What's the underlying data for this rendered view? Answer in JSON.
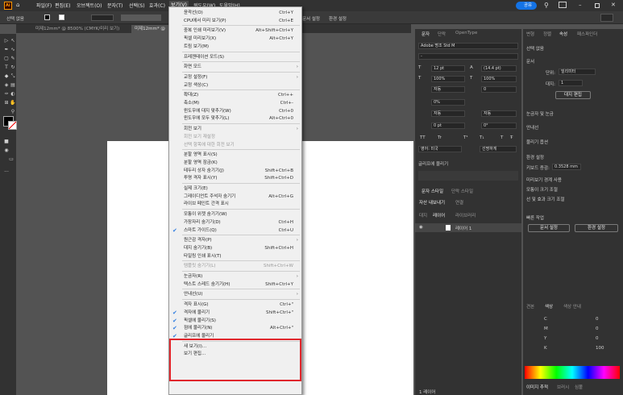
{
  "menubar": {
    "items": [
      "파일(F)",
      "편집(E)",
      "오브젝트(O)",
      "문자(T)",
      "선택(S)",
      "효과(C)",
      "보기(V)",
      "윈도우(W)",
      "도움말(H)"
    ],
    "share": "공유"
  },
  "control": {
    "selection": "선택 없음",
    "workspace_fields": [
      "스타일:",
      "문서 설정",
      "환경 설정"
    ]
  },
  "doc_tabs": [
    "미제12mm* @ 8500% (CMYK/미리 보기)",
    "미제12mm* @"
  ],
  "view_menu": {
    "items": [
      {
        "label": "윤곽선(O)",
        "shortcut": "Ctrl+Y"
      },
      {
        "label": "CPU에서 미리 보기(P)",
        "shortcut": "Ctrl+E"
      },
      {
        "sep": true
      },
      {
        "label": "중복 인쇄 미리보기(V)",
        "shortcut": "Alt+Shift+Ctrl+Y"
      },
      {
        "label": "픽셀 미리보기(X)",
        "shortcut": "Alt+Ctrl+Y"
      },
      {
        "label": "트림 보기(M)"
      },
      {
        "sep": true
      },
      {
        "label": "프레젠테이션 모드(S)"
      },
      {
        "sep": true
      },
      {
        "label": "화면 모드",
        "submenu": true
      },
      {
        "sep": true
      },
      {
        "label": "교정 설정(F)",
        "submenu": true
      },
      {
        "label": "교정 색상(C)"
      },
      {
        "sep": true
      },
      {
        "label": "확대(Z)",
        "shortcut": "Ctrl++"
      },
      {
        "label": "축소(M)",
        "shortcut": "Ctrl+-"
      },
      {
        "label": "윈도우에 대지 맞추기(W)",
        "shortcut": "Ctrl+0"
      },
      {
        "label": "윈도우에 모두 맞추기(L)",
        "shortcut": "Alt+Ctrl+0"
      },
      {
        "sep": true
      },
      {
        "label": "회전 보기",
        "submenu": true
      },
      {
        "label": "회전 보기 재설정",
        "disabled": true
      },
      {
        "label": "선택 항목에 대한 회전 보기",
        "disabled": true
      },
      {
        "sep": true
      },
      {
        "label": "분할 영역 표시(S)"
      },
      {
        "label": "분할 영역 잠금(K)"
      },
      {
        "label": "테두리 상자 숨기기(J)",
        "shortcut": "Shift+Ctrl+B"
      },
      {
        "label": "투명 격자 표시(Y)",
        "shortcut": "Shift+Ctrl+D"
      },
      {
        "sep": true
      },
      {
        "label": "실제 크기(E)"
      },
      {
        "label": "그레이디언트 주석자 숨기기",
        "shortcut": "Alt+Ctrl+G"
      },
      {
        "label": "라이브 페인트 간격 표시"
      },
      {
        "sep": true
      },
      {
        "label": "모퉁이 위젯 숨기기(W)"
      },
      {
        "label": "가장자리 숨기기(D)",
        "shortcut": "Ctrl+H"
      },
      {
        "label": "스마트 가이드(Q)",
        "shortcut": "Ctrl+U",
        "checked": true
      },
      {
        "sep": true
      },
      {
        "label": "원근감 격자(P)",
        "submenu": true
      },
      {
        "label": "대지 숨기기(B)",
        "shortcut": "Shift+Ctrl+H"
      },
      {
        "label": "타일링 인쇄 표시(T)"
      },
      {
        "sep": true
      },
      {
        "label": "템플릿 숨기기(L)",
        "shortcut": "Shift+Ctrl+W",
        "disabled": true
      },
      {
        "sep": true
      },
      {
        "label": "눈금자(R)",
        "submenu": true
      },
      {
        "label": "텍스트 스레드 숨기기(H)",
        "shortcut": "Shift+Ctrl+Y"
      },
      {
        "sep": true
      },
      {
        "label": "안내선(U)",
        "submenu": true
      },
      {
        "sep": true
      },
      {
        "label": "격자 표시(G)",
        "shortcut": "Ctrl+\""
      },
      {
        "label": "격자에 물리기",
        "shortcut": "Shift+Ctrl+\"",
        "checked": true
      },
      {
        "label": "픽셀에 물리기(S)",
        "checked": true
      },
      {
        "label": "점에 물리기(N)",
        "shortcut": "Alt+Ctrl+\"",
        "checked": true
      },
      {
        "label": "글리프에 물리기",
        "checked": true
      },
      {
        "sep": true
      },
      {
        "label": "새 보기(I)..."
      },
      {
        "label": "보기 편집..."
      }
    ]
  },
  "char_panel": {
    "tabs": [
      "문자",
      "단락",
      "OpenType"
    ],
    "font": "Adobe 명조 Std M",
    "style": "-",
    "size": "12 pt",
    "leading": "(14.4 pt)",
    "scale_v": "100%",
    "scale_h": "100%",
    "auto": "자동",
    "tracking": "0",
    "tsume": "0%",
    "aki1": "자동",
    "aki2": "자동",
    "baseline": "0 pt",
    "rotation": "0°",
    "tt_row": [
      "TT",
      "Tr",
      "T¹",
      "T₁",
      "T",
      "Ŧ"
    ],
    "lang": "영어: 미국",
    "aa": "선명하게",
    "snap_label": "글리프에 물리기",
    "bottom_tabs": [
      "문자 스타일",
      "단락 스타일"
    ],
    "asset_tabs": [
      "자산 내보내기",
      "연결"
    ],
    "layer_tabs": [
      "대지",
      "레이어",
      "라이브러리"
    ],
    "layer_name": "레이어 1",
    "footer": "1 레이어"
  },
  "props_panel": {
    "tabs": [
      "변형",
      "정렬",
      "속성",
      "패스파인더"
    ],
    "none": "선택 없음",
    "doc": "문서",
    "unit_label": "단위:",
    "unit": "밀리미터",
    "artboard_label": "대지:",
    "artboard": "1",
    "edit_artboard": "대지 편집",
    "ruler_grid": "눈금자 및 눈금",
    "guides": "안내선",
    "snap": "물리기 옵션",
    "prefs": "환경 설정",
    "keyinc_label": "키보드 증감:",
    "keyinc": "0.3528 mm",
    "cb1": "미리보기 경계 사용",
    "cb2": "모퉁이 크기 조절",
    "cb3": "선 및 효과 크기 조절",
    "quick": "빠른 작업",
    "doc_setup": "문서 설정",
    "env_setup": "환경 설정"
  },
  "color_panel": {
    "tabs": [
      "견본",
      "색상",
      "색상 안내"
    ],
    "channels": [
      {
        "name": "C",
        "val": "0"
      },
      {
        "name": "M",
        "val": "0"
      },
      {
        "name": "Y",
        "val": "0"
      },
      {
        "name": "K",
        "val": "100"
      }
    ],
    "bottom_tabs": [
      "이미지 추적",
      "브러시",
      "심볼"
    ]
  }
}
